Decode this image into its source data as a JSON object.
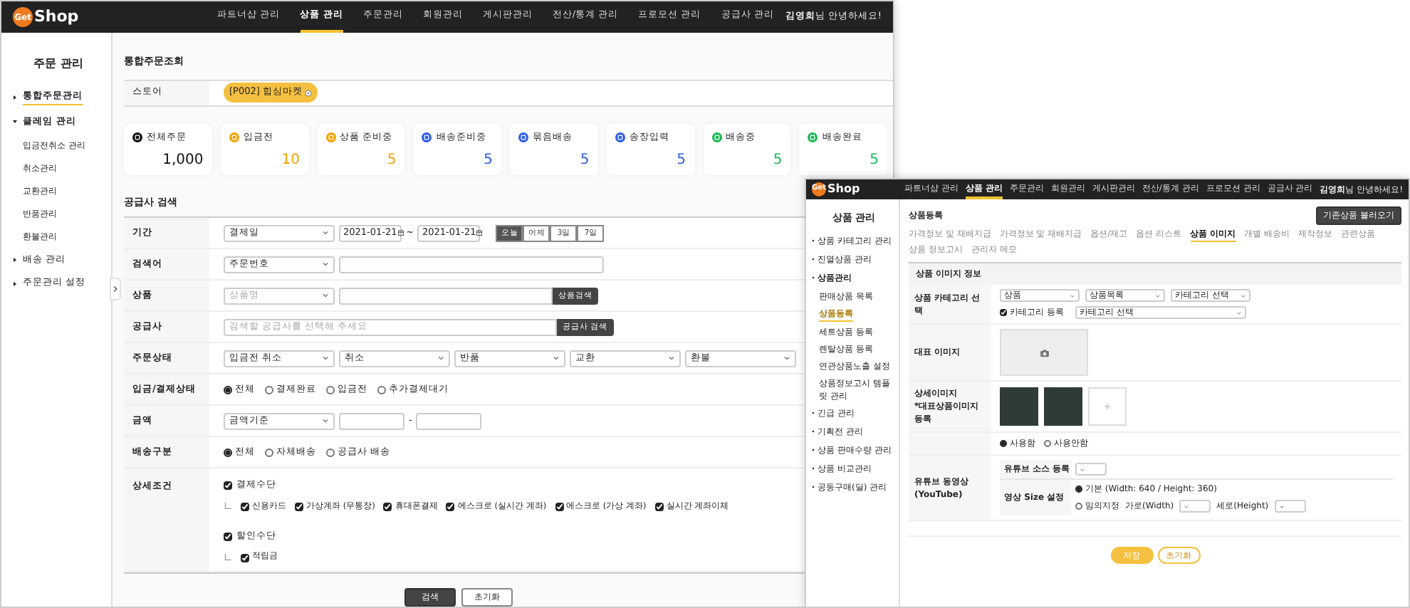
{
  "left_window": {
    "header": {
      "logo": {
        "badge": "Get",
        "text": "Shop"
      },
      "nav": [
        {
          "label": "파트너샵 관리",
          "selected": false
        },
        {
          "label": "상품 관리",
          "selected": true
        },
        {
          "label": "주문관리",
          "selected": false
        },
        {
          "label": "회원관리",
          "selected": false
        },
        {
          "label": "게시판관리",
          "selected": false
        },
        {
          "label": "전산/통계 관리",
          "selected": false
        },
        {
          "label": "프로모션 관리",
          "selected": false
        },
        {
          "label": "공급사 관리",
          "selected": false
        }
      ],
      "greeting": "**김영희**님 안녕하세요!"
    },
    "sidebar": {
      "title": "주문 관리",
      "items": [
        {
          "label": "통합주문관리",
          "selected": true,
          "expanded": false
        },
        {
          "label": "클레임 관리",
          "selected": false,
          "expanded": true,
          "children": [
            {
              "label": "입금전취소 관리"
            },
            {
              "label": "취소관리"
            },
            {
              "label": "교환관리"
            },
            {
              "label": "반품관리"
            },
            {
              "label": "환불관리"
            }
          ]
        },
        {
          "label": "배송 관리",
          "selected": false,
          "expanded": false
        },
        {
          "label": "주문관리 설정",
          "selected": false,
          "expanded": false
        }
      ]
    },
    "page_title": "통합주문조회",
    "store": {
      "label": "스토어",
      "chip": "[P002] 힙심마켓"
    },
    "stats": [
      {
        "label": "전체주문",
        "value": "1,000",
        "color": "#111111"
      },
      {
        "label": "입금전",
        "value": "10",
        "color": "#f5a300"
      },
      {
        "label": "상품 준비중",
        "value": "5",
        "color": "#f5a300"
      },
      {
        "label": "배송준비중",
        "value": "5",
        "color": "#2f5fe8"
      },
      {
        "label": "묶음배송",
        "value": "5",
        "color": "#2f5fe8"
      },
      {
        "label": "송장입력",
        "value": "5",
        "color": "#2f5fe8"
      },
      {
        "label": "배송중",
        "value": "5",
        "color": "#1db954"
      },
      {
        "label": "배송완료",
        "value": "5",
        "color": "#1db954"
      }
    ],
    "search": {
      "title": "공급사 검색",
      "rows": [
        {
          "label": "기간",
          "controls": [
            {
              "kind": "select",
              "value": "결제일"
            },
            {
              "kind": "date",
              "value": "2021-01-21"
            },
            {
              "kind": "text",
              "text": "~"
            },
            {
              "kind": "date",
              "value": "2021-01-21"
            },
            {
              "kind": "segmented",
              "options": [
                {
                  "label": "오늘",
                  "selected": true
                },
                {
                  "label": "어제",
                  "selected": false
                },
                {
                  "label": "3일",
                  "selected": false
                },
                {
                  "label": "7일",
                  "selected": false
                }
              ]
            }
          ]
        },
        {
          "label": "검색어",
          "controls": [
            {
              "kind": "select",
              "value": "주문번호"
            },
            {
              "kind": "input"
            }
          ]
        },
        {
          "label": "상품",
          "controls": [
            {
              "kind": "select",
              "placeholder": "상품명"
            },
            {
              "kind": "search",
              "button": "상품검색"
            }
          ]
        },
        {
          "label": "공급사",
          "controls": [
            {
              "kind": "search",
              "placeholder": "검색할 공급사를 선택해 주세요",
              "button": "공급사 검색"
            }
          ]
        },
        {
          "label": "주문상태",
          "controls": [
            {
              "kind": "select",
              "value": "입금전 취소"
            },
            {
              "kind": "select",
              "value": "취소"
            },
            {
              "kind": "select",
              "value": "반품"
            },
            {
              "kind": "select",
              "value": "교환"
            },
            {
              "kind": "select",
              "value": "환불"
            }
          ]
        },
        {
          "label": "입금/결제상태",
          "controls": [
            {
              "kind": "radio",
              "options": [
                {
                  "label": "전체",
                  "selected": true
                },
                {
                  "label": "결제완료",
                  "selected": false
                },
                {
                  "label": "입금전",
                  "selected": false
                },
                {
                  "label": "추가결제대기",
                  "selected": false
                }
              ]
            }
          ]
        },
        {
          "label": "금액",
          "controls": [
            {
              "kind": "select",
              "value": "금액기준"
            },
            {
              "kind": "number"
            },
            {
              "kind": "text",
              "text": "-"
            },
            {
              "kind": "number"
            }
          ]
        },
        {
          "label": "배송구분",
          "controls": [
            {
              "kind": "radio",
              "options": [
                {
                  "label": "전체",
                  "selected": true
                },
                {
                  "label": "자체배송",
                  "selected": false
                },
                {
                  "label": "공급사 배송",
                  "selected": false
                }
              ]
            }
          ]
        },
        {
          "label": "상세조건",
          "controls": [
            {
              "kind": "checkgroup",
              "label": "결제수단",
              "checked": true,
              "children": [
                {
                  "label": "신용카드",
                  "checked": true
                },
                {
                  "label": "가상계좌 (무통장)",
                  "checked": true
                },
                {
                  "label": "휴대폰결제",
                  "checked": true
                },
                {
                  "label": "에스크로 (실시간 계좌)",
                  "checked": true
                },
                {
                  "label": "에스크로 (가상 계좌)",
                  "checked": true
                },
                {
                  "label": "실시간 계좌이체",
                  "checked": true
                }
              ]
            },
            {
              "kind": "checkgroup",
              "label": "할인수단",
              "checked": true,
              "children": [
                {
                  "label": "적립금",
                  "checked": true
                }
              ]
            }
          ]
        }
      ]
    },
    "actions": [
      {
        "label": "검색",
        "kind": "primary"
      },
      {
        "label": "초기화",
        "kind": "secondary"
      }
    ]
  },
  "right_window": {
    "header": {
      "logo": {
        "badge": "Get",
        "text": "Shop"
      },
      "nav": [
        {
          "label": "파트너샵 관리",
          "selected": false
        },
        {
          "label": "상품 관리",
          "selected": true
        },
        {
          "label": "주문관리",
          "selected": false
        },
        {
          "label": "회원관리",
          "selected": false
        },
        {
          "label": "게시판관리",
          "selected": false
        },
        {
          "label": "전산/통계 관리",
          "selected": false
        },
        {
          "label": "프로모션 관리",
          "selected": false
        },
        {
          "label": "공급사 관리",
          "selected": false
        }
      ],
      "greeting": "**김영희**님 안녕하세요!"
    },
    "sidebar": {
      "title": "상품 관리",
      "items": [
        {
          "label": "상품 카테고리 관리",
          "expanded": false
        },
        {
          "label": "진열상품 관리",
          "expanded": false
        },
        {
          "label": "상품관리",
          "expanded": true,
          "children": [
            {
              "label": "판매상품 목록",
              "selected": false
            },
            {
              "label": "상품등록",
              "selected": true
            },
            {
              "label": "세트상품 등록",
              "selected": false
            },
            {
              "label": "렌탈상품 등록",
              "selected": false
            },
            {
              "label": "연관상품노출 설정",
              "selected": false
            },
            {
              "label": "상품정보고시 템플릿 관리",
              "selected": false
            }
          ]
        },
        {
          "label": "긴급 관리",
          "expanded": false
        },
        {
          "label": "기획전 관리",
          "expanded": false
        },
        {
          "label": "상품 판매수량 관리",
          "expanded": false
        },
        {
          "label": "상품 비교관리",
          "expanded": false
        },
        {
          "label": "공동구매(딜) 관리",
          "expanded": false
        }
      ]
    },
    "page_title": "상품등록",
    "load_button": "기존상품 불러오기",
    "tabs": [
      {
        "label": "가격정보 및 재배지급",
        "selected": false
      },
      {
        "label": "가격정보 및 재배지급",
        "selected": false
      },
      {
        "label": "옵션/재고",
        "selected": false
      },
      {
        "label": "옵션 리스트",
        "selected": false
      },
      {
        "label": "상품 이미지",
        "selected": true
      },
      {
        "label": "개별 배송비",
        "selected": false
      },
      {
        "label": "제작정보",
        "selected": false
      },
      {
        "label": "관련상품",
        "selected": false
      },
      {
        "label": "상품 정보고시",
        "selected": false
      },
      {
        "label": "관리자 메모",
        "selected": false
      }
    ],
    "section_title": "상품 이미지 정보",
    "rows": [
      {
        "kind": "category",
        "label": "상품 카테고리 선택",
        "selects": [
          "상품",
          "상품목록",
          "카테고리 선택"
        ],
        "check": {
          "label": "카테고리 등록",
          "checked": true
        },
        "select": "카테고리 선택"
      },
      {
        "kind": "image",
        "label": "대표 이미지"
      },
      {
        "kind": "gallery",
        "label": "상세이미지",
        "sublabel": "*대표상품이미지 등록"
      },
      {
        "kind": "usage",
        "options": [
          {
            "label": "사용함",
            "selected": true
          },
          {
            "label": "사용안함",
            "selected": false
          }
        ]
      },
      {
        "kind": "youtube",
        "label": "유튜브 동영상",
        "sublabel": "(YouTube)",
        "source_label": "유튜브 소스 등록",
        "size_label": "영상 Size 설정",
        "size_options": [
          {
            "label": "기본 (Width: 640 / Height: 360)",
            "selected": true
          },
          {
            "label": "임의지정",
            "selected": false
          }
        ],
        "width_label": "가로(Width)",
        "height_label": "세로(Height)"
      }
    ],
    "actions": [
      {
        "label": "저장",
        "kind": "primary"
      },
      {
        "label": "초기화",
        "kind": "secondary"
      }
    ]
  }
}
